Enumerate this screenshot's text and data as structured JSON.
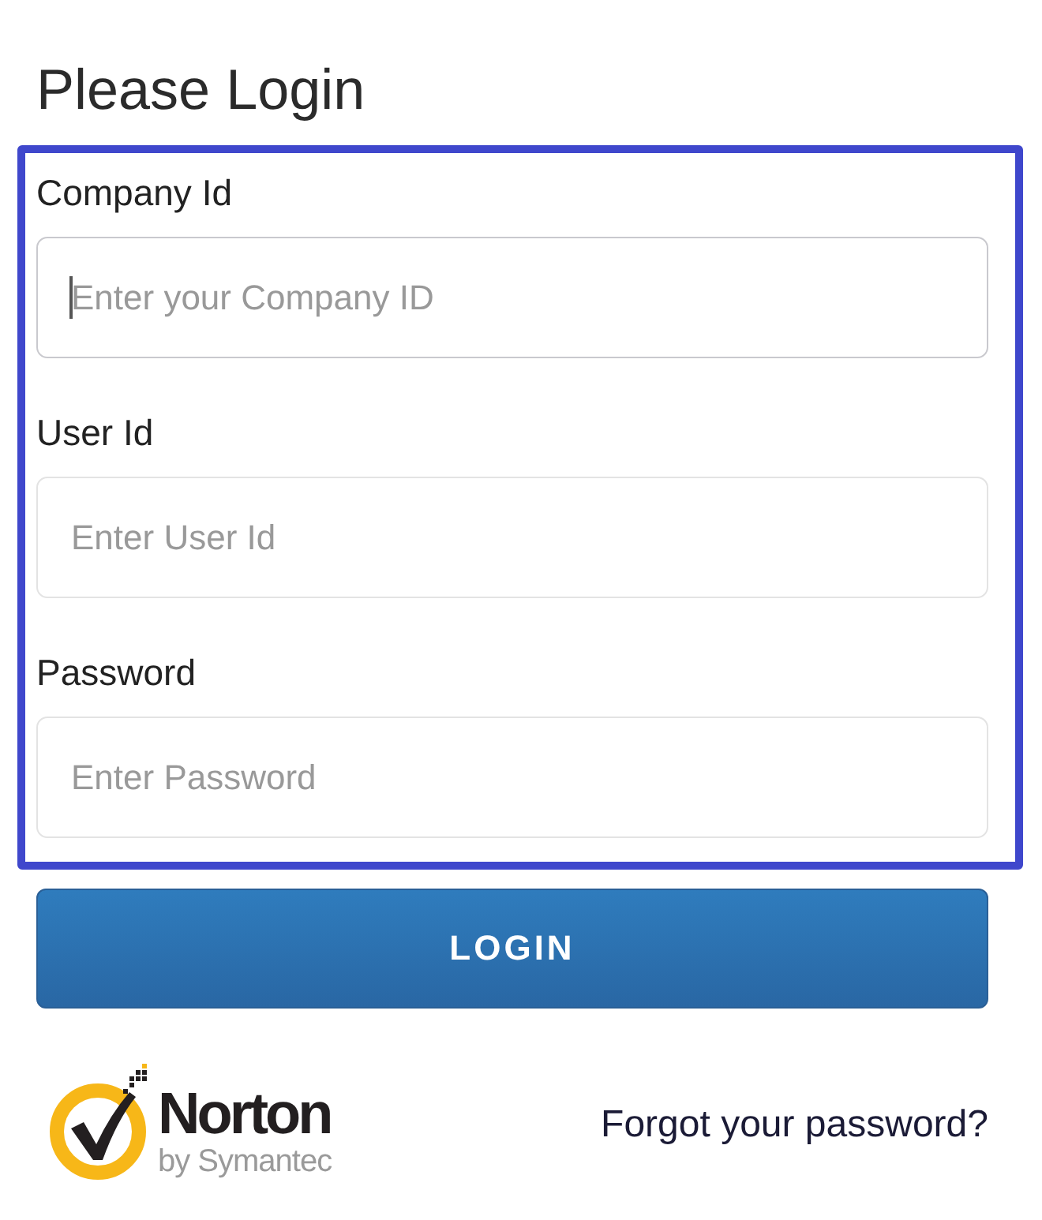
{
  "title": "Please Login",
  "fields": [
    {
      "label": "Company Id",
      "placeholder": "Enter your Company ID",
      "focused": true
    },
    {
      "label": "User Id",
      "placeholder": "Enter User Id",
      "focused": false
    },
    {
      "label": "Password",
      "placeholder": "Enter Password",
      "focused": false
    }
  ],
  "login_button": {
    "label": "LOGIN"
  },
  "logo": {
    "name": "Norton",
    "tagline": "by Symantec"
  },
  "forgot_link": {
    "label": "Forgot your password?"
  }
}
